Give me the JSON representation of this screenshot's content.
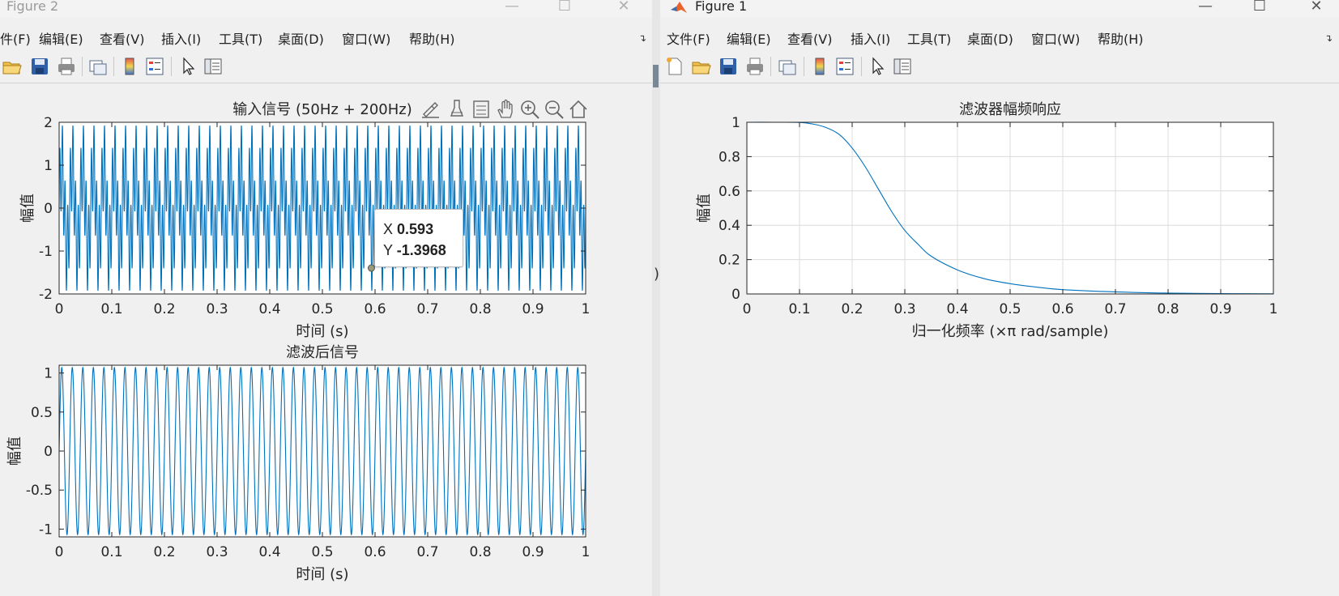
{
  "figure2": {
    "title": "Figure 2",
    "menu": [
      "件(F)",
      "编辑(E)",
      "查看(V)",
      "插入(I)",
      "工具(T)",
      "桌面(D)",
      "窗口(W)",
      "帮助(H)"
    ],
    "axes_toolbar_icons": [
      "brush-icon",
      "data-cursor-icon",
      "legend-icon",
      "pan-icon",
      "zoom-in-icon",
      "zoom-out-icon",
      "home-icon"
    ],
    "datatip": {
      "x_label": "X",
      "x_value": "0.593",
      "y_label": "Y",
      "y_value": "-1.3968"
    }
  },
  "figure1": {
    "title": "Figure 1",
    "menu": [
      "文件(F)",
      "编辑(E)",
      "查看(V)",
      "插入(I)",
      "工具(T)",
      "桌面(D)",
      "窗口(W)",
      "帮助(H)"
    ]
  },
  "colors": {
    "line": "#0072BD",
    "axes": "#262626",
    "grid": "#dcdcdc"
  },
  "chart_data": [
    {
      "type": "line",
      "title": "输入信号 (50Hz + 200Hz)",
      "xlabel": "时间 (s)",
      "ylabel": "幅值",
      "xlim": [
        0,
        1
      ],
      "ylim": [
        -2,
        2
      ],
      "xticks": [
        "0",
        "0.1",
        "0.2",
        "0.3",
        "0.4",
        "0.5",
        "0.6",
        "0.7",
        "0.8",
        "0.9",
        "1"
      ],
      "yticks": [
        "-2",
        "-1",
        "0",
        "1",
        "2"
      ],
      "series": [
        {
          "formula": "sin(2π·50t) + sin(2π·200t)",
          "components_hz": [
            50,
            200
          ],
          "amplitude": 2
        }
      ],
      "grid": false
    },
    {
      "type": "line",
      "title": "滤波后信号",
      "xlabel": "时间 (s)",
      "ylabel": "幅值",
      "xlim": [
        0,
        1
      ],
      "ylim": [
        -1.1,
        1.1
      ],
      "xticks": [
        "0",
        "0.1",
        "0.2",
        "0.3",
        "0.4",
        "0.5",
        "0.6",
        "0.7",
        "0.8",
        "0.9",
        "1"
      ],
      "yticks": [
        "-1",
        "-0.5",
        "0",
        "0.5",
        "1"
      ],
      "series": [
        {
          "formula": "sin(2π·50t)",
          "components_hz": [
            50
          ],
          "amplitude": 1
        }
      ],
      "grid": false
    },
    {
      "type": "line",
      "title": "滤波器幅频响应",
      "xlabel": "归一化频率 (×π rad/sample)",
      "ylabel": "幅值",
      "xlim": [
        0,
        1
      ],
      "ylim": [
        0,
        1
      ],
      "xticks": [
        "0",
        "0.1",
        "0.2",
        "0.3",
        "0.4",
        "0.5",
        "0.6",
        "0.7",
        "0.8",
        "0.9",
        "1"
      ],
      "yticks": [
        "0",
        "0.2",
        "0.4",
        "0.6",
        "0.8",
        "1"
      ],
      "x": [
        0,
        0.05,
        0.1,
        0.125,
        0.15,
        0.175,
        0.2,
        0.225,
        0.25,
        0.275,
        0.3,
        0.325,
        0.35,
        0.4,
        0.45,
        0.5,
        0.55,
        0.6,
        0.7,
        0.8,
        0.9,
        1.0
      ],
      "series": [
        {
          "values": [
            1.0,
            1.0,
            0.999,
            0.99,
            0.97,
            0.93,
            0.85,
            0.74,
            0.61,
            0.48,
            0.37,
            0.29,
            0.22,
            0.14,
            0.09,
            0.06,
            0.04,
            0.025,
            0.012,
            0.005,
            0.002,
            0.001
          ]
        }
      ],
      "grid": true
    }
  ]
}
